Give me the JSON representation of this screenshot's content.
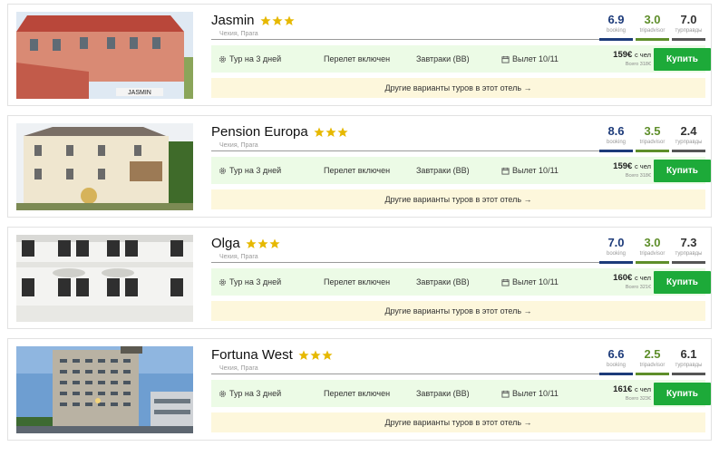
{
  "colors": {
    "booking": "#1d3b7a",
    "tripadvisor": "#5e8e2a",
    "turpravdy": "#555555",
    "buy": "#1daa39",
    "offer_bg": "#ecfbe6",
    "more_bg": "#fdf7dc",
    "star": "#e6b800"
  },
  "labels": {
    "booking": "booking",
    "tripadvisor": "tripadvisor",
    "turpravdy": "турправды",
    "tour": "Тур на 3 дней",
    "flight": "Перелет включен",
    "meals": "Завтраки (BB)",
    "per_person": "с чел",
    "buy": "Купить",
    "more": "Другие варианты туров в этот отель →"
  },
  "hotels": [
    {
      "name": "Jasmin",
      "stars": 3,
      "location": "Чехия, Прага",
      "ratings": {
        "booking": "6.9",
        "tripadvisor": "3.0",
        "turpravdy": "7.0"
      },
      "departure": "Вылет 10/11",
      "price": "159€",
      "total": "Всего 318€",
      "sign_text": "JASMIN"
    },
    {
      "name": "Pension Europa",
      "stars": 3,
      "location": "Чехия, Прага",
      "ratings": {
        "booking": "8.6",
        "tripadvisor": "3.5",
        "turpravdy": "2.4"
      },
      "departure": "Вылет 10/11",
      "price": "159€",
      "total": "Всего 318€"
    },
    {
      "name": "Olga",
      "stars": 3,
      "location": "Чехия, Прага",
      "ratings": {
        "booking": "7.0",
        "tripadvisor": "3.0",
        "turpravdy": "7.3"
      },
      "departure": "Вылет 10/11",
      "price": "160€",
      "total": "Всего 321€"
    },
    {
      "name": "Fortuna West",
      "stars": 3,
      "location": "Чехия, Прага",
      "ratings": {
        "booking": "6.6",
        "tripadvisor": "2.5",
        "turpravdy": "6.1"
      },
      "departure": "Вылет 10/11",
      "price": "161€",
      "total": "Всего 323€"
    }
  ]
}
